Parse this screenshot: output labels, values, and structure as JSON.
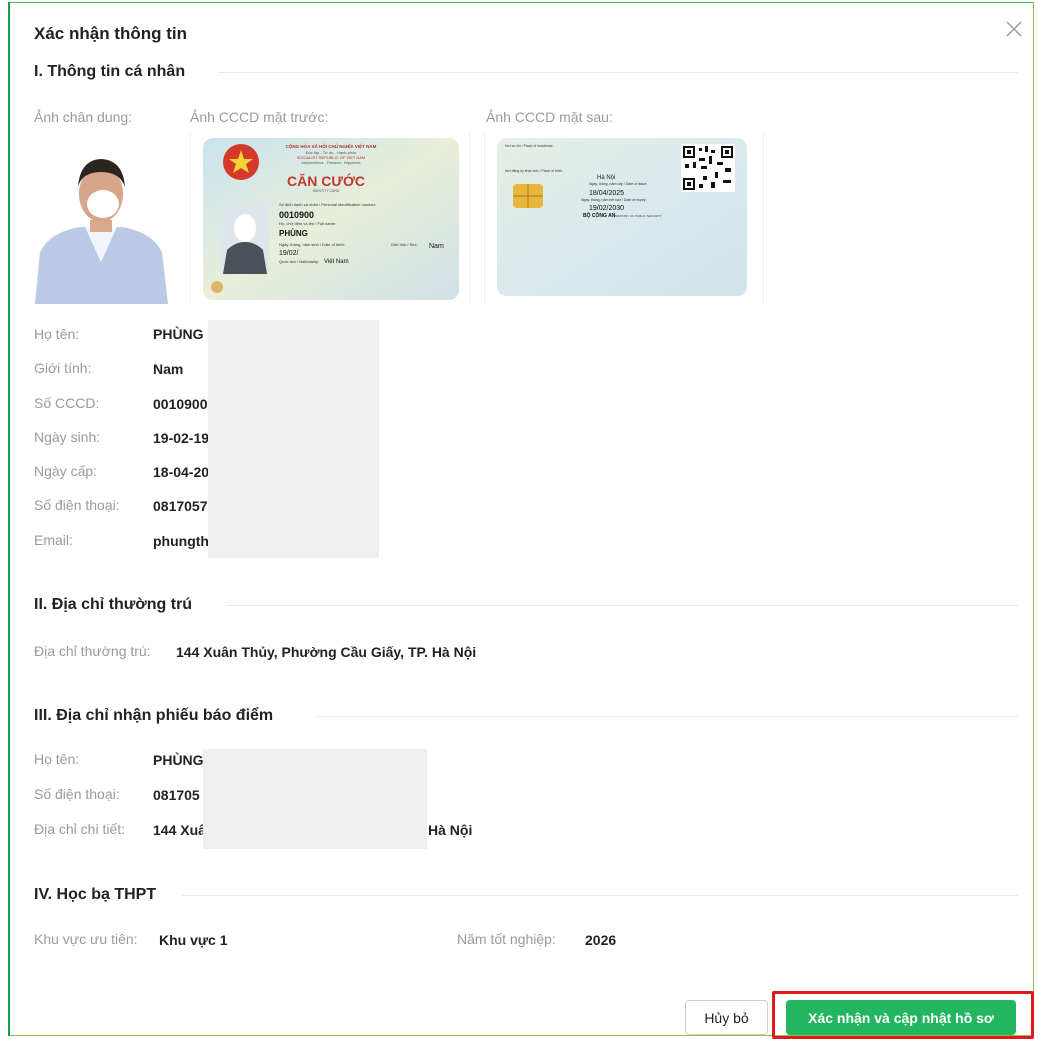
{
  "dialog": {
    "title": "Xác nhận thông tin"
  },
  "section1": {
    "heading": "I. Thông tin cá nhân",
    "photo_labels": {
      "portrait": "Ảnh chân dung:",
      "front": "Ảnh CCCD mặt trước:",
      "back": "Ảnh CCCD mặt sau:"
    },
    "card_front": {
      "header1": "CỘNG HÒA XÃ HỘI CHỦ NGHĨA VIỆT NAM",
      "header2": "Độc lập - Tự do - Hạnh phúc",
      "header3": "SOCIALIST REPUBLIC OF VIET NAM",
      "header4": "Independence - Freedom - Happiness",
      "title": "CĂN CƯỚC",
      "subtitle": "IDENTITY CARD",
      "id_label": "Số định danh cá nhân / Personal identification number:",
      "id_value": "0010900",
      "name_label": "Họ, chữ đệm và tên / Full name:",
      "name_value": "PHÙNG",
      "dob_label": "Ngày, tháng, năm sinh / Date of birth:",
      "dob_value": "19/02/",
      "sex_label": "Giới tính / Sex:",
      "sex_value": "Nam",
      "nat_label": "Quốc tịch / Nationality:",
      "nat_value": "Việt Nam"
    },
    "card_back": {
      "residence_label": "Nơi cư trú / Place of residence:",
      "birth_label": "Nơi đăng ký khai sinh / Place of birth:",
      "birth_value": "Hà Nội",
      "issue_label": "Ngày, tháng, năm cấp / Date of issue:",
      "issue_value": "18/04/2025",
      "expiry_label": "Ngày, tháng, năm hết hạn / Date of expiry:",
      "expiry_value": "19/02/2030",
      "authority": "BỘ CÔNG AN",
      "authority_en": "MINISTRY OF PUBLIC SECURITY"
    },
    "fields": [
      {
        "label": "Họ tên:",
        "value": "PHÙNG"
      },
      {
        "label": "Giới tính:",
        "value": "Nam"
      },
      {
        "label": "Số CCCD:",
        "value": "0010900"
      },
      {
        "label": "Ngày sinh:",
        "value": "19-02-19"
      },
      {
        "label": "Ngày cấp:",
        "value": "18-04-20"
      },
      {
        "label": "Số điện thoại:",
        "value": "0817057"
      },
      {
        "label": "Email:",
        "value": "phungth"
      }
    ]
  },
  "section2": {
    "heading": "II. Địa chỉ thường trú",
    "label": "Địa chỉ thường trú:",
    "value": "144 Xuân Thủy, Phường Cầu Giấy, TP. Hà Nội"
  },
  "section3": {
    "heading": "III. Địa chỉ nhận phiếu báo điểm",
    "fields": [
      {
        "label": "Họ tên:",
        "value": "PHÙNG"
      },
      {
        "label": "Số điện thoại:",
        "value": "081705"
      },
      {
        "label": "Địa chỉ chi tiết:",
        "value": "144 Xuâ",
        "value_tail": "Hà Nội"
      }
    ]
  },
  "section4": {
    "heading": "IV. Học bạ THPT",
    "priority_label": "Khu vực ưu tiên:",
    "priority_value": "Khu vực 1",
    "grad_label": "Năm tốt nghiệp:",
    "grad_value": "2026"
  },
  "buttons": {
    "cancel": "Hủy bỏ",
    "confirm": "Xác nhận và cập nhật hồ sơ"
  },
  "colors": {
    "primary": "#23b560",
    "highlight": "#e01919"
  }
}
